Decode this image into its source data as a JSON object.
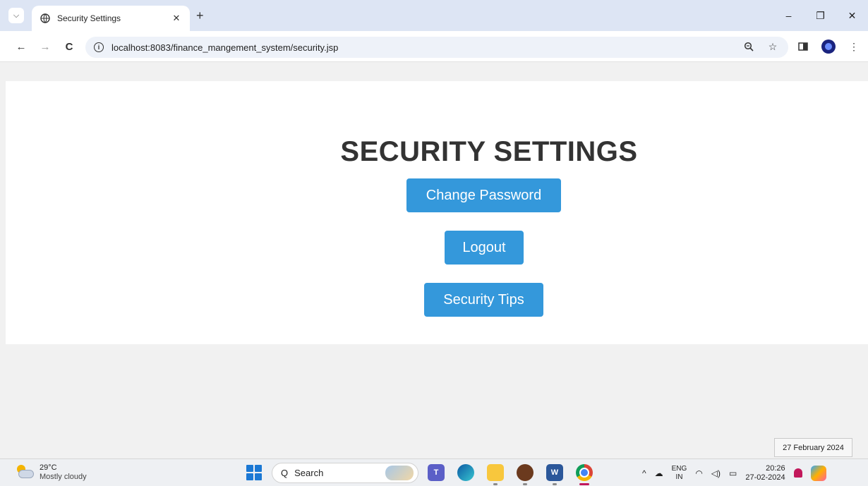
{
  "browser": {
    "tab": {
      "title": "Security Settings",
      "close_glyph": "✕"
    },
    "new_tab_glyph": "+",
    "window_controls": {
      "minimize": "–",
      "restore": "❐",
      "close": "✕"
    },
    "nav": {
      "back": "←",
      "forward": "→",
      "reload": "C"
    },
    "url": "localhost:8083/finance_mangement_system/security.jsp",
    "info_glyph": "i"
  },
  "page": {
    "title": "SECURITY SETTINGS",
    "buttons": {
      "change_password": "Change Password",
      "logout": "Logout",
      "security_tips": "Security Tips"
    },
    "colors": {
      "button": "#3498db",
      "title": "#333333"
    }
  },
  "tooltip": {
    "date": "27 February 2024"
  },
  "taskbar": {
    "weather": {
      "temp": "29°C",
      "desc": "Mostly cloudy"
    },
    "search": {
      "label": "Search",
      "glyph": "Q"
    },
    "apps": {
      "teams": "T",
      "word": "W"
    },
    "tray": {
      "chevron": "^",
      "lang_line1": "ENG",
      "lang_line2": "IN",
      "time": "20:26",
      "date": "27-02-2024"
    }
  }
}
